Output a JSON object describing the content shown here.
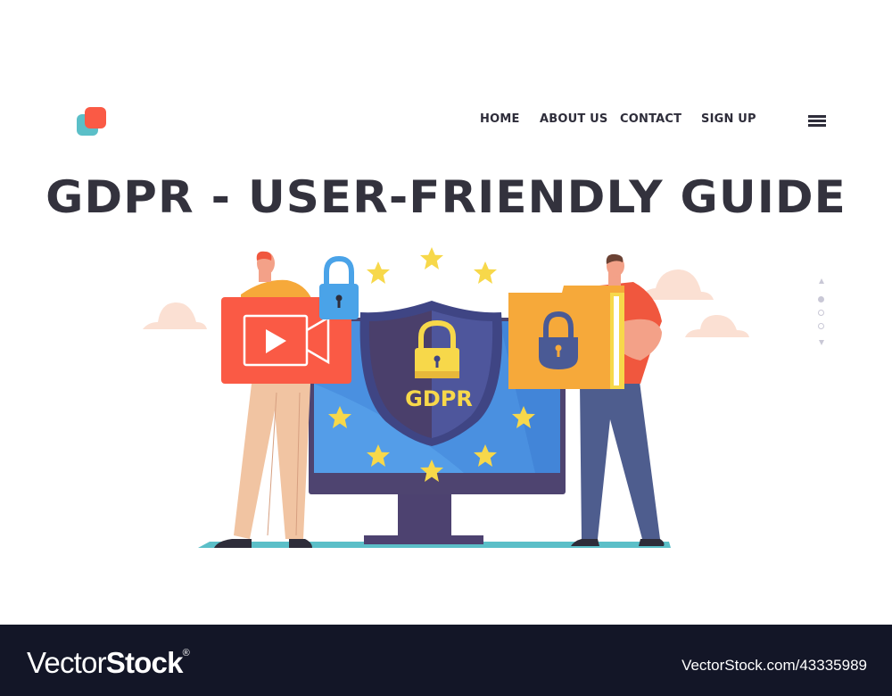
{
  "header": {
    "logo": "logo-two-squares",
    "nav": [
      {
        "label": "HOME"
      },
      {
        "label": "ABOUT US"
      },
      {
        "label": "CONTACT"
      },
      {
        "label": "SIGN UP"
      }
    ],
    "menu_icon": "hamburger-menu-icon"
  },
  "hero": {
    "title": "GDPR - USER-FRIENDLY GUIDE",
    "shield_label": "GDPR"
  },
  "pager": {
    "total": 3,
    "active_index": 0
  },
  "illustration": {
    "elements": [
      "monitor",
      "shield",
      "padlock",
      "eu-stars",
      "video-camera-card",
      "locked-folder",
      "man-left",
      "man-right",
      "clouds"
    ]
  },
  "footer": {
    "brand_light": "Vector",
    "brand_bold": "Stock",
    "brand_mark": "®",
    "reference": "VectorStock.com/43335989"
  },
  "colors": {
    "text_dark": "#33323d",
    "logo_red": "#fa5a45",
    "logo_teal": "#5bbfc8",
    "monitor_blue": "#4a90e0",
    "shield_navy": "#3f4584",
    "star_yellow": "#f7d84a",
    "folder_orange": "#f6a93a",
    "card_red": "#fa5a45",
    "footer_bg": "#131627"
  }
}
